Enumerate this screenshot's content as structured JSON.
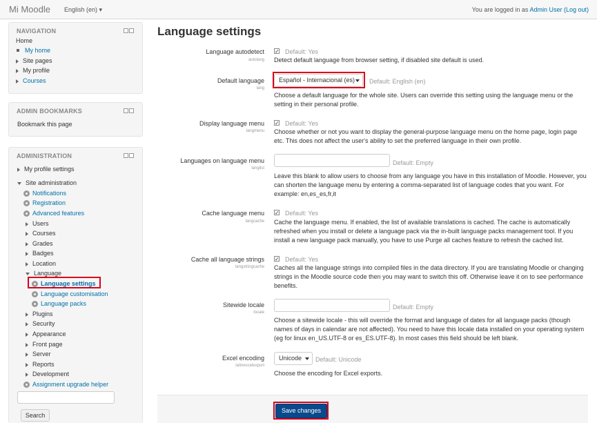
{
  "header": {
    "brand": "Mi Moodle",
    "language": "English (en) ▾",
    "login_prefix": "You are logged in as ",
    "user": "Admin User",
    "logout": "(Log out)"
  },
  "navigation": {
    "title": "NAVIGATION",
    "home": "Home",
    "items": [
      "My home",
      "Site pages",
      "My profile",
      "Courses"
    ]
  },
  "bookmarks": {
    "title": "ADMIN BOOKMARKS",
    "link": "Bookmark this page"
  },
  "administration": {
    "title": "ADMINISTRATION",
    "my_profile": "My profile settings",
    "site_admin": "Site administration",
    "gear_items": [
      "Notifications",
      "Registration",
      "Advanced features"
    ],
    "folders": [
      "Users",
      "Courses",
      "Grades",
      "Badges",
      "Location"
    ],
    "language": "Language",
    "language_children": [
      "Language settings",
      "Language customisation",
      "Language packs"
    ],
    "folders2": [
      "Plugins",
      "Security",
      "Appearance",
      "Front page",
      "Server",
      "Reports",
      "Development"
    ],
    "assign_helper": "Assignment upgrade helper",
    "search_button": "Search"
  },
  "page": {
    "title": "Language settings",
    "save_button": "Save changes"
  },
  "settings": {
    "autodetect": {
      "label": "Language autodetect",
      "key": "autolang",
      "default": "Default: Yes",
      "desc": "Detect default language from browser setting, if disabled site default is used."
    },
    "defaultlang": {
      "label": "Default language",
      "key": "lang",
      "value": "Español - Internacional (es)",
      "default": "Default: English (en)",
      "desc": "Choose a default language for the whole site. Users can override this setting using the language menu or the setting in their personal profile."
    },
    "langmenu": {
      "label": "Display language menu",
      "key": "langmenu",
      "default": "Default: Yes",
      "desc": "Choose whether or not you want to display the general-purpose language menu on the home page, login page etc. This does not affect the user's ability to set the preferred language in their own profile."
    },
    "langlist": {
      "label": "Languages on language menu",
      "key": "langlist",
      "default": "Default: Empty",
      "desc": "Leave this blank to allow users to choose from any language you have in this installation of Moodle. However, you can shorten the language menu by entering a comma-separated list of language codes that you want. For example: en,es_es,fr,it"
    },
    "langcache": {
      "label": "Cache language menu",
      "key": "langcache",
      "default": "Default: Yes",
      "desc": "Cache the language menu. If enabled, the list of available translations is cached. The cache is automatically refreshed when you install or delete a language pack via the in-built language packs management tool. If you install a new language pack manually, you have to use Purge all caches feature to refresh the cached list."
    },
    "stringcache": {
      "label": "Cache all language strings",
      "key": "langstringcache",
      "default": "Default: Yes",
      "desc": "Caches all the language strings into compiled files in the data directory. If you are translating Moodle or changing strings in the Moodle source code then you may want to switch this off. Otherwise leave it on to see performance benefits."
    },
    "locale": {
      "label": "Sitewide locale",
      "key": "locale",
      "default": "Default: Empty",
      "desc": "Choose a sitewide locale - this will override the format and language of dates for all language packs (though names of days in calendar are not affected). You need to have this locale data installed on your operating system (eg for linux en_US.UTF-8 or es_ES.UTF-8). In most cases this field should be left blank."
    },
    "excel": {
      "label": "Excel encoding",
      "key": "latinexcelexport",
      "value": "Unicode",
      "default": "Default: Unicode",
      "desc": "Choose the encoding for Excel exports."
    }
  },
  "colors": {
    "highlight": "#d9001b",
    "link": "#0070a8",
    "button": "#0a4a8c"
  }
}
